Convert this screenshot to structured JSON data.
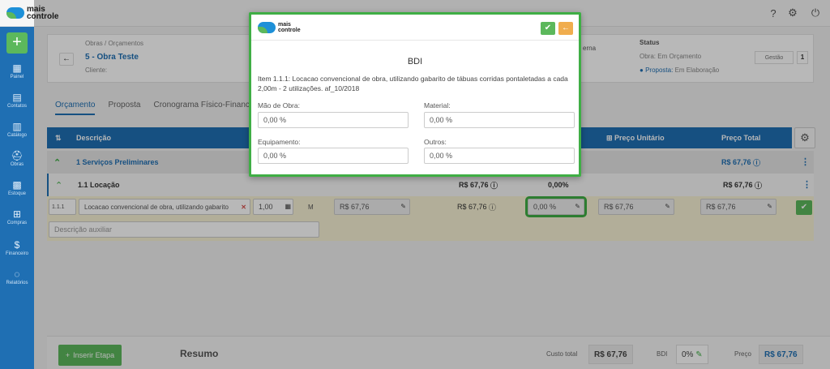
{
  "app": {
    "logo_line1": "mais",
    "logo_line2": "controle"
  },
  "topbar": {
    "help_icon": "help-circle-icon",
    "settings_icon": "gear-icon",
    "power_icon": "power-icon"
  },
  "sidebar": {
    "add_label": "+",
    "items": [
      {
        "label": "Painel",
        "icon": "dashboard-icon"
      },
      {
        "label": "Contatos",
        "icon": "contacts-icon"
      },
      {
        "label": "Catálogo",
        "icon": "catalog-icon"
      },
      {
        "label": "Obras",
        "icon": "helmet-icon"
      },
      {
        "label": "Estoque",
        "icon": "stock-icon"
      },
      {
        "label": "Compras",
        "icon": "cart-icon"
      },
      {
        "label": "Financeiro",
        "icon": "dollar-icon"
      },
      {
        "label": "Relatórios",
        "icon": "reports-icon"
      }
    ]
  },
  "header": {
    "breadcrumb": "Obras / Orçamentos",
    "work_title": "5 - Obra Teste",
    "client_label": "Cliente:",
    "erna_label": "erna",
    "status_label": "Status",
    "status_obra_label": "Obra:",
    "status_obra_value": "Em Orçamento",
    "status_proposta_label": "Proposta:",
    "status_proposta_value": "Em Elaboração",
    "gestao_label": "Gestão",
    "counter": "1"
  },
  "tabs": [
    "Orçamento",
    "Proposta",
    "Cronograma Físico-Finance"
  ],
  "table": {
    "headers": {
      "descricao": "Descrição",
      "preco_unitario": "Preço Unitário",
      "preco_total": "Preço Total"
    },
    "stage": {
      "label": "1   Serviços Preliminares",
      "total": "R$ 67,76"
    },
    "substage": {
      "label": "1.1   Locação",
      "unit_total": "R$ 67,76",
      "bdi": "0,00%",
      "total": "R$ 67,76"
    },
    "item": {
      "code": "1.1.1",
      "description": "Locacao convencional de obra, utilizando gabarito",
      "quantity": "1,00",
      "unit": "M",
      "custo": "R$ 67,76",
      "custo_total": "R$ 67,76",
      "bdi": "0,00 %",
      "preco_unitario": "R$ 67,76",
      "preco_total": "R$ 67,76",
      "aux_placeholder": "Descrição auxiliar"
    }
  },
  "footer": {
    "insert_label": "Inserir Etapa",
    "resumo": "Resumo",
    "custo_total_label": "Custo total",
    "custo_total_value": "R$ 67,76",
    "bdi_label": "BDI",
    "bdi_value": "0%",
    "preco_label": "Preço",
    "preco_value": "R$ 67,76"
  },
  "modal": {
    "title": "BDI",
    "description": "Item 1.1.1: Locacao convencional de obra, utilizando gabarito de tábuas corridas pontaletadas a cada 2,00m - 2 utilizações. af_10/2018",
    "fields": {
      "mao_de_obra": {
        "label": "Mão de Obra:",
        "value": "0,00 %"
      },
      "material": {
        "label": "Material:",
        "value": "0,00 %"
      },
      "equipamento": {
        "label": "Equipamento:",
        "value": "0,00 %"
      },
      "outros": {
        "label": "Outros:",
        "value": "0,00 %"
      }
    },
    "confirm_icon": "check-icon",
    "back_icon": "arrow-left-icon"
  },
  "colors": {
    "primary": "#1f6fb3",
    "success": "#5cb85c",
    "warning": "#f0ad4e",
    "highlight": "#3fae45"
  }
}
